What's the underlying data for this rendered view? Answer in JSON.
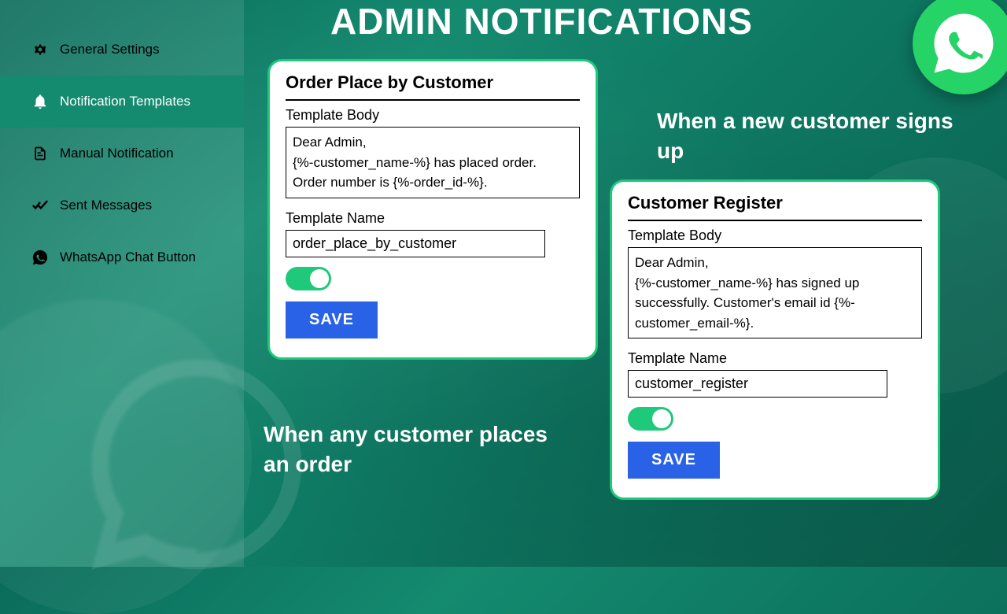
{
  "page_title": "ADMIN NOTIFICATIONS",
  "sidebar": {
    "items": [
      {
        "label": "General Settings"
      },
      {
        "label": "Notification Templates"
      },
      {
        "label": "Manual Notification"
      },
      {
        "label": "Sent Messages"
      },
      {
        "label": "WhatsApp Chat Button"
      }
    ]
  },
  "card1": {
    "title": "Order Place by Customer",
    "body_label": "Template Body",
    "body": "Dear Admin,\n{%-customer_name-%} has placed order.\nOrder number is {%-order_id-%}.",
    "name_label": "Template Name",
    "name": "order_place_by_customer",
    "save": "SAVE",
    "callout": "When any customer places an order"
  },
  "card2": {
    "title": "Customer Register",
    "body_label": "Template Body",
    "body": "Dear Admin,\n{%-customer_name-%} has signed up successfully. Customer's email id {%-customer_email-%}.",
    "name_label": "Template Name",
    "name": "customer_register",
    "save": "SAVE",
    "callout": "When a new customer signs up"
  }
}
